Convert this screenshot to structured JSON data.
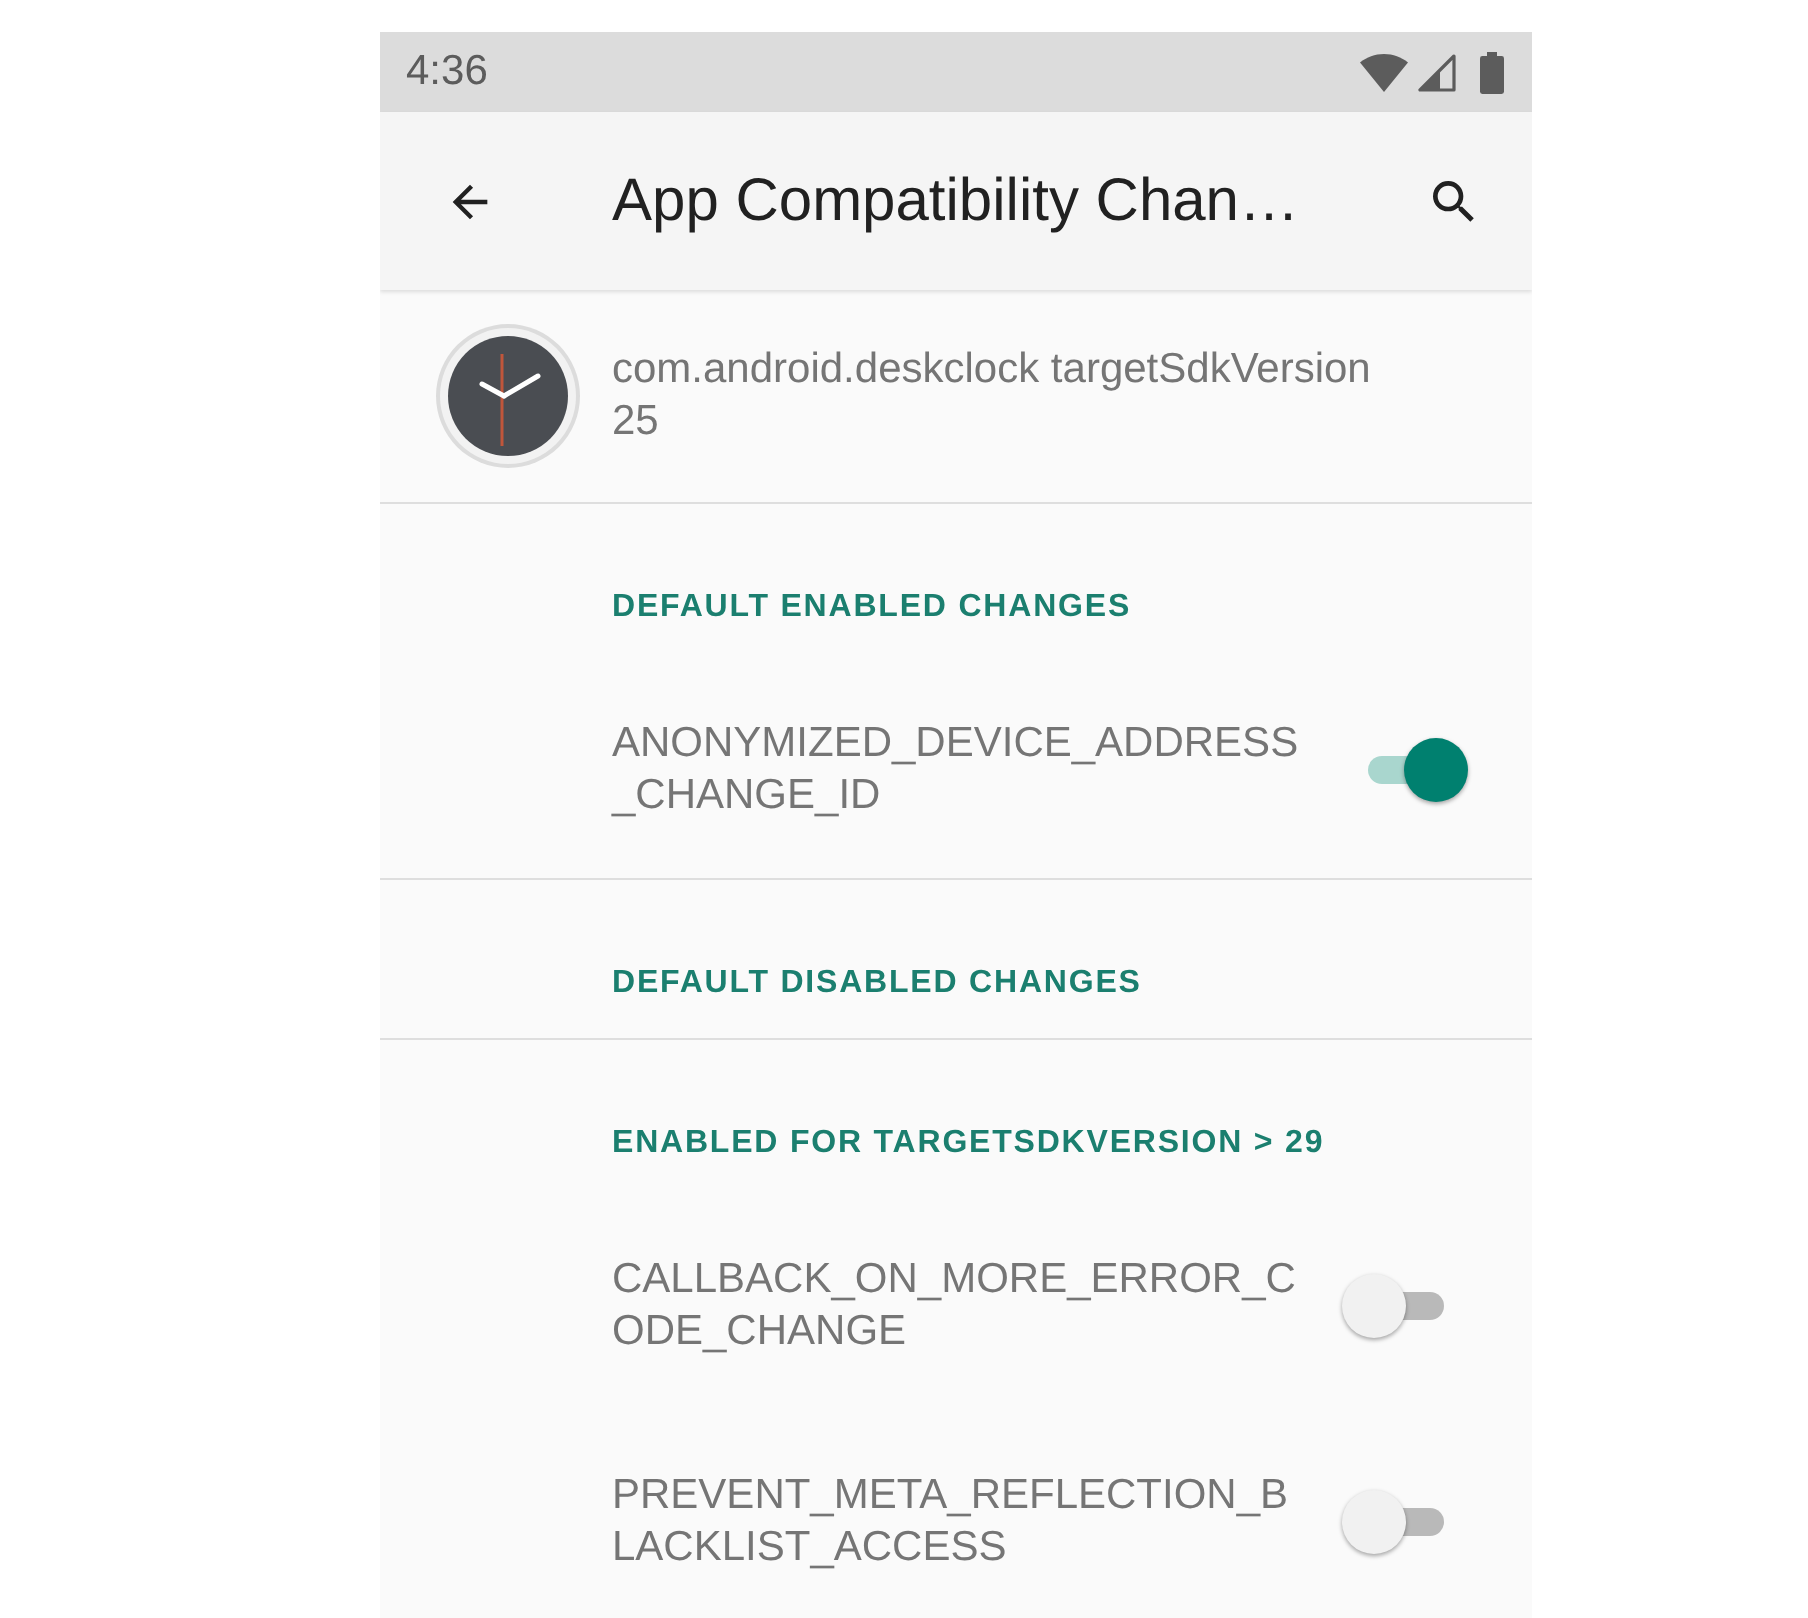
{
  "status_bar": {
    "time": "4:36"
  },
  "app_bar": {
    "title": "App Compatibility Chan…"
  },
  "app_info": {
    "label": "com.android.deskclock targetSdkVersion 25"
  },
  "sections": [
    {
      "title": "DEFAULT ENABLED CHANGES",
      "items": [
        {
          "label": "ANONYMIZED_DEVICE_ADDRESS_CHANGE_ID",
          "on": true
        }
      ]
    },
    {
      "title": "DEFAULT DISABLED CHANGES"
    },
    {
      "title": "ENABLED FOR TARGETSDKVERSION > 29",
      "items": [
        {
          "label": "CALLBACK_ON_MORE_ERROR_CODE_CHANGE",
          "on": false
        },
        {
          "label": "PREVENT_META_REFLECTION_BLACKLIST_ACCESS",
          "on": false
        }
      ]
    }
  ]
}
